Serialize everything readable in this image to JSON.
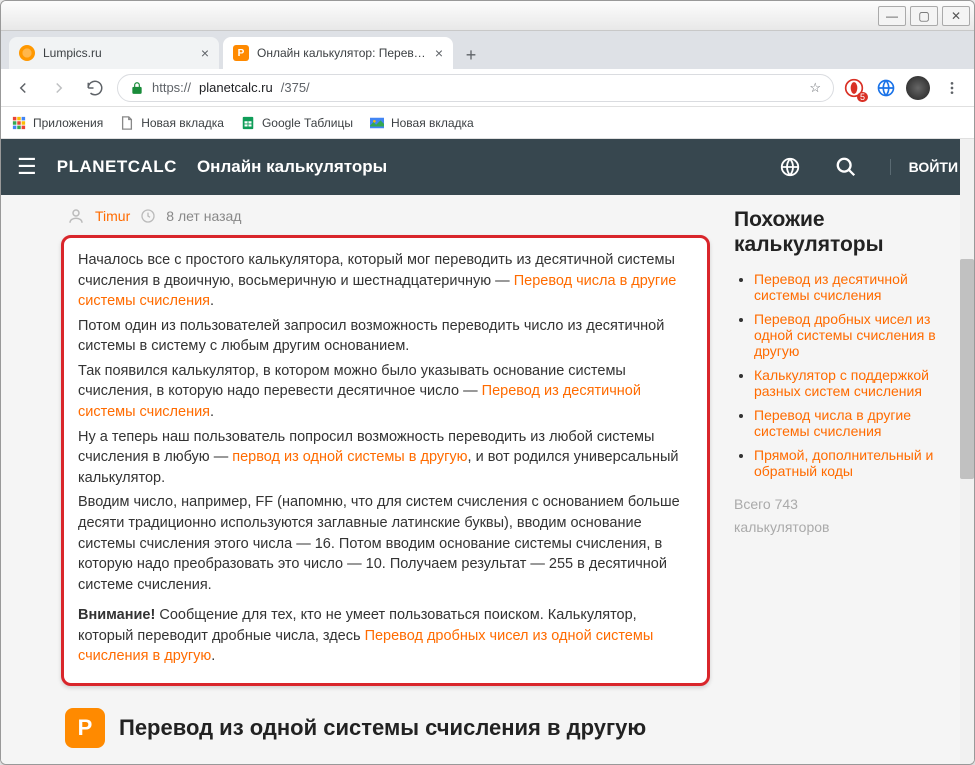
{
  "window": {
    "controls": {
      "min": "—",
      "max": "▢",
      "close": "✕"
    }
  },
  "tabs": [
    {
      "title": "Lumpics.ru",
      "favicon_color": "#ff9800",
      "active": false
    },
    {
      "title": "Онлайн калькулятор: Перевод и",
      "favicon_color": "#ff8a00",
      "favicon_letter": "P",
      "active": true
    }
  ],
  "address": {
    "scheme": "https://",
    "domain": "planetcalc.ru",
    "path": "/375/"
  },
  "extensions": {
    "badge_count": "5"
  },
  "bookmarks": [
    {
      "label": "Приложения",
      "icon": "apps"
    },
    {
      "label": "Новая вкладка",
      "icon": "page"
    },
    {
      "label": "Google Таблицы",
      "icon": "sheets"
    },
    {
      "label": "Новая вкладка",
      "icon": "img"
    }
  ],
  "header": {
    "brand": "PLANETCALC",
    "subtitle": "Онлайн калькуляторы",
    "login": "ВОЙТИ"
  },
  "author": {
    "name": "Timur",
    "time": "8 лет назад"
  },
  "article": {
    "p1_a": "Началось все с простого калькулятора, который мог переводить из десятичной системы счисления в двоичную, восьмеричную и шестнадцатеричную — ",
    "p1_link": "Перевод числа в другие системы счисления",
    "p1_b": ".",
    "p2": "Потом один из пользователей запросил возможность переводить число из десятичной системы в систему с любым другим основанием.",
    "p3_a": "Так появился калькулятор, в котором можно было указывать основание системы счисления, в которую надо перевести десятичное число — ",
    "p3_link": "Перевод из десятичной системы счисления",
    "p3_b": ".",
    "p4_a": "Ну а теперь наш пользователь попросил возможность переводить из любой системы счисления в любую — ",
    "p4_link": "первод из одной системы в другую",
    "p4_b": ", и вот родился универсальный калькулятор.",
    "p5": "Вводим число, например, FF (напомню, что для систем счисления с основанием больше десяти традиционно используются заглавные латинские буквы), вводим основание системы счисления этого числа — 16. Потом вводим основание системы счисления, в которую надо преобразовать это число — 10. Получаем результат — 255 в десятичной системе счисления.",
    "p6_strong": "Внимание!",
    "p6_a": " Сообщение для тех, кто не умеет пользоваться поиском. Калькулятор, который переводит дробные числа, здесь ",
    "p6_link": "Перевод дробных чисел из одной системы счисления в другую",
    "p6_b": "."
  },
  "calculator": {
    "logo_letter": "P",
    "title": "Перевод из одной системы счисления в другую"
  },
  "sidebar": {
    "title": "Похожие калькуляторы",
    "items": [
      "Перевод из десятичной системы счисления",
      "Перевод дробных чисел из одной системы счисления в другую",
      "Калькулятор с поддержкой разных систем счисления",
      "Перевод числа в другие системы счисления",
      "Прямой, дополнительный и обратный коды"
    ],
    "total_a": "Всего 743",
    "total_b": "калькуляторов"
  }
}
